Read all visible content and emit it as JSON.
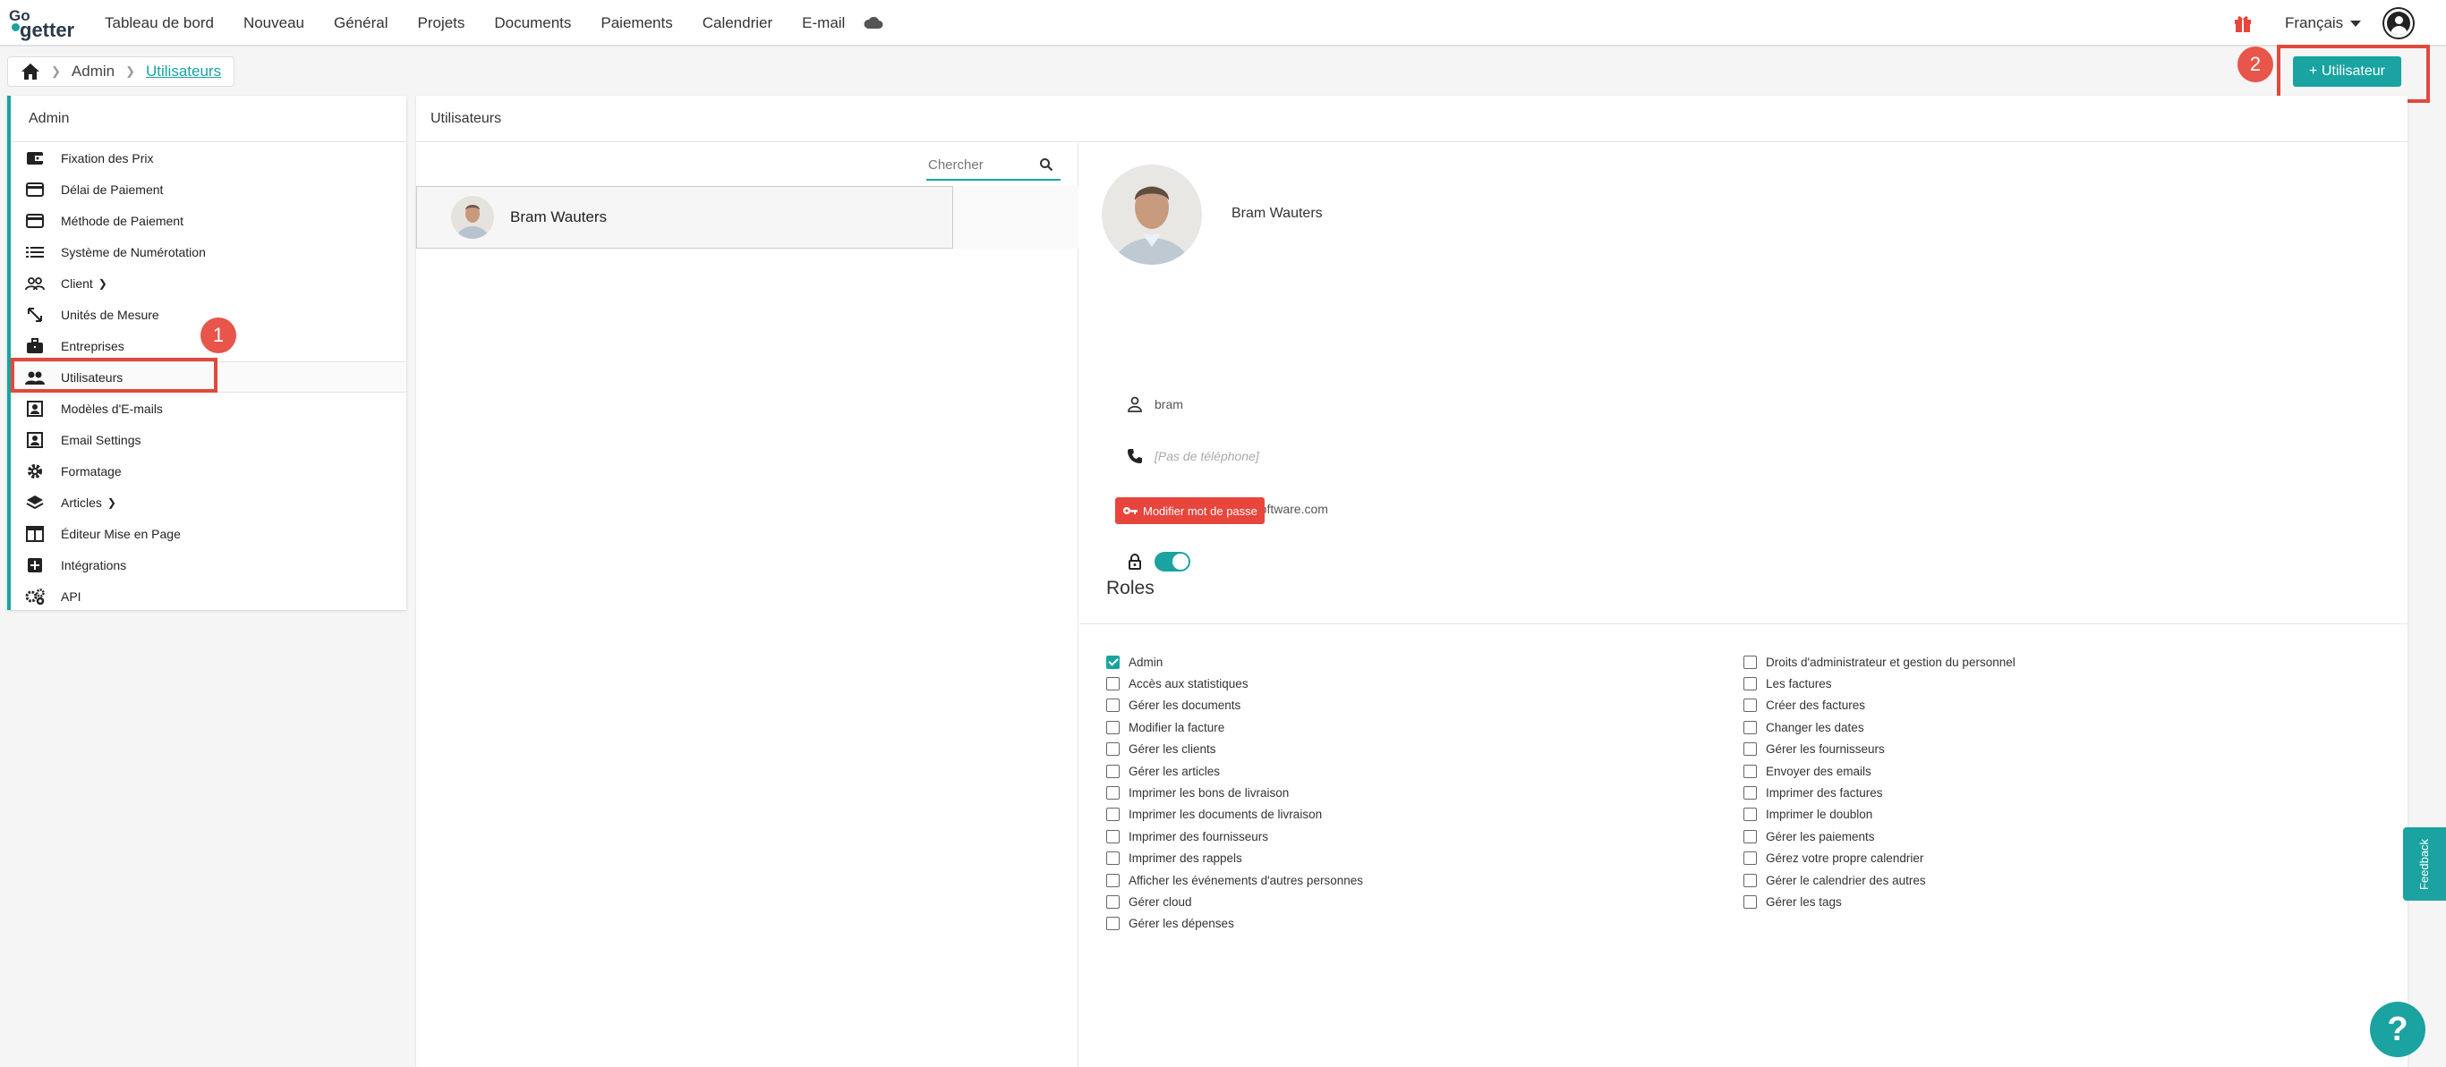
{
  "brand": {
    "logo_top": "Go",
    "logo_bottom": "getter"
  },
  "nav": {
    "items": [
      {
        "label": "Tableau de bord"
      },
      {
        "label": "Nouveau"
      },
      {
        "label": "Général"
      },
      {
        "label": "Projets"
      },
      {
        "label": "Documents"
      },
      {
        "label": "Paiements"
      },
      {
        "label": "Calendrier"
      },
      {
        "label": "E-mail"
      }
    ],
    "language": "Français"
  },
  "breadcrumb": {
    "parent": "Admin",
    "current": "Utilisateurs"
  },
  "add_user_button": {
    "label": "+ Utilisateur"
  },
  "annotations": {
    "badge1": "1",
    "badge2": "2"
  },
  "sidebar": {
    "title": "Admin",
    "items": [
      {
        "label": "Fixation des Prix",
        "icon": "wallet-icon"
      },
      {
        "label": "Délai de Paiement",
        "icon": "credit-card-icon"
      },
      {
        "label": "Méthode de Paiement",
        "icon": "credit-card-icon"
      },
      {
        "label": "Système de Numérotation",
        "icon": "list-icon"
      },
      {
        "label": "Client",
        "icon": "people-icon"
      },
      {
        "label": "Unités de Mesure",
        "icon": "resize-icon"
      },
      {
        "label": "Entreprises",
        "icon": "briefcase-icon"
      },
      {
        "label": "Utilisateurs",
        "icon": "users-icon"
      },
      {
        "label": "Modèles d'E-mails",
        "icon": "email-template-icon"
      },
      {
        "label": "Email Settings",
        "icon": "email-template-icon"
      },
      {
        "label": "Formatage",
        "icon": "gear-icon"
      },
      {
        "label": "Articles",
        "icon": "layers-icon"
      },
      {
        "label": "Éditeur Mise en Page",
        "icon": "layout-icon"
      },
      {
        "label": "Intégrations",
        "icon": "plus-box-icon"
      },
      {
        "label": "API",
        "icon": "gears-icon"
      }
    ]
  },
  "main": {
    "title": "Utilisateurs",
    "search_placeholder": "Chercher",
    "users": [
      {
        "name": "Bram Wauters"
      }
    ]
  },
  "detail": {
    "name": "Bram Wauters",
    "username": "bram",
    "phone_placeholder": "[Pas de téléphone]",
    "email": "bwauters@striktlysoftware.com",
    "active": true,
    "change_password_label": "Modifier mot de passe",
    "roles_title": "Roles",
    "roles_left": [
      {
        "label": "Admin",
        "checked": true
      },
      {
        "label": "Accès aux statistiques",
        "checked": false
      },
      {
        "label": "Gérer les documents",
        "checked": false
      },
      {
        "label": "Modifier la facture",
        "checked": false
      },
      {
        "label": "Gérer les clients",
        "checked": false
      },
      {
        "label": "Gérer les articles",
        "checked": false
      },
      {
        "label": "Imprimer les bons de livraison",
        "checked": false
      },
      {
        "label": "Imprimer les documents de livraison",
        "checked": false
      },
      {
        "label": "Imprimer des fournisseurs",
        "checked": false
      },
      {
        "label": "Imprimer des rappels",
        "checked": false
      },
      {
        "label": "Afficher les événements d'autres personnes",
        "checked": false
      },
      {
        "label": "Gérer cloud",
        "checked": false
      },
      {
        "label": "Gérer les dépenses",
        "checked": false
      }
    ],
    "roles_right": [
      {
        "label": "Droits d'administrateur et gestion du personnel",
        "checked": false
      },
      {
        "label": "Les factures",
        "checked": false
      },
      {
        "label": "Créer des factures",
        "checked": false
      },
      {
        "label": "Changer les dates",
        "checked": false
      },
      {
        "label": "Gérer les fournisseurs",
        "checked": false
      },
      {
        "label": "Envoyer des emails",
        "checked": false
      },
      {
        "label": "Imprimer des factures",
        "checked": false
      },
      {
        "label": "Imprimer le doublon",
        "checked": false
      },
      {
        "label": "Gérer les paiements",
        "checked": false
      },
      {
        "label": "Gérez votre propre calendrier",
        "checked": false
      },
      {
        "label": "Gérer le calendrier des autres",
        "checked": false
      },
      {
        "label": "Gérer les tags",
        "checked": false
      }
    ]
  },
  "feedback": {
    "label": "Feedback"
  },
  "help": {
    "label": "?"
  },
  "colors": {
    "accent": "#1aa3a0",
    "danger": "#e8453c",
    "highlight": "#e0493e"
  }
}
